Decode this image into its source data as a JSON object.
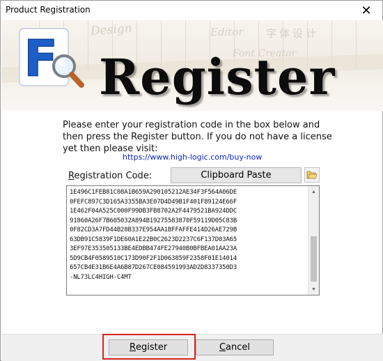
{
  "window": {
    "title": "Product Registration",
    "close_glyph": "✕"
  },
  "banner": {
    "heading": "Register",
    "bg_words": [
      "Design",
      "Editor",
      "字体设计",
      "Font Creator"
    ],
    "logo_letter": "F",
    "logo_icon": "magnifier-icon",
    "colors": {
      "logo_blue": "#1d5fc7",
      "lens_handle": "#b5652a",
      "heading": "#0c0c0c"
    }
  },
  "instructions": {
    "text": "Please enter your registration code in the box below and then press the Register button. If you do not have a license yet then please visit:",
    "link": "https://www.high-logic.com/buy-now"
  },
  "code_field": {
    "label_first": "R",
    "label_rest": "egistration Code:",
    "clipboard_button": "Clipboard Paste",
    "folder_icon": "folder-open-icon",
    "lines": [
      "1E496C1FEB81C08A1B659A290105212AE34F3F564A06DE",
      "0FEFC897C3D165A3355BA3E07D4D49B1F401F89124E66F",
      "1E462F04A525C000F99DB3FB8702A2F4479521BA924DDC",
      "91860A26F7B605032A894B19275583870F59119D05C83B",
      "0F82CD3A7FD44B28B337E954AA1BFFAFFE414D26AE729B",
      "63DB91C5839F1DE60A1E22B0C2623D2237C6F137D03A65",
      "3EF97E353505133BE4EDBB474FE27940B0BFBEA01AA23A",
      "5D9CB4F0589510C173D90F2F1D063859F2358F01E14014",
      "657CB4E31B6E4A6B87D267CE084591993AD2D8337350D3",
      "-NL73LC4HIGH-C4MT"
    ],
    "scrollbar": {
      "up_glyph": "▲",
      "down_glyph": "▼"
    }
  },
  "buttons": {
    "register_mn": "R",
    "register_rest": "egister",
    "cancel_mn": "C",
    "cancel_rest": "ancel",
    "highlight_color": "#d9231c"
  }
}
